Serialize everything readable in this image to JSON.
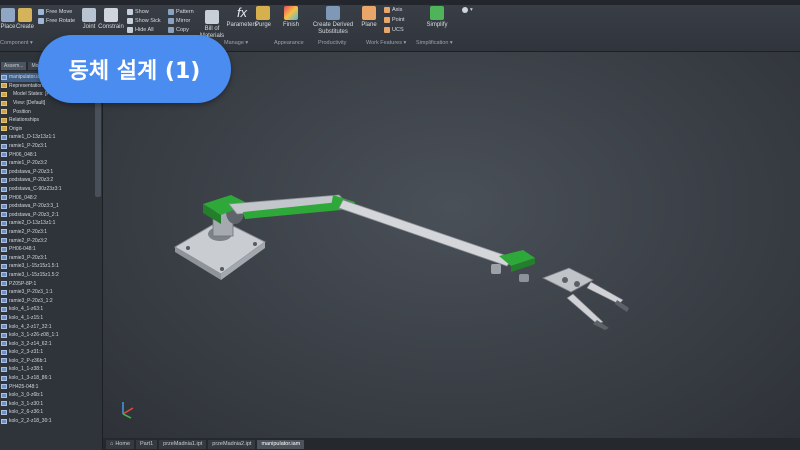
{
  "badge": {
    "title": "동체 설계 (1)"
  },
  "ribbon": {
    "place_label": "Place",
    "create_label": "Create",
    "free_move": "Free Move",
    "free_rotate": "Free Rotate",
    "joint_label": "Joint",
    "constrain_label": "Constrain",
    "show": "Show",
    "show_sick": "Show Sick",
    "hide_all": "Hide All",
    "pattern": "Pattern",
    "mirror": "Mirror",
    "copy": "Copy",
    "bill_of_materials": "Bill of Materials",
    "parameters": "Parameters",
    "purge": "Purge",
    "finish": "Finish",
    "create_derived": "Create Derived Substitutes",
    "plane": "Plane",
    "axis": "Axis",
    "point": "Point",
    "ucs": "UCS",
    "simplify": "Simplify",
    "groups": {
      "component": "Component ▾",
      "manage": "Manage ▾",
      "appearance": "Appearance",
      "productivity": "Productivity",
      "work_features": "Work Features ▾",
      "simplification": "Simplification ▾"
    }
  },
  "browser": {
    "tabs": [
      "Assem...",
      "Mod..."
    ],
    "items": [
      "manipulator.iam",
      "Representations",
      "Model States: [Prim...",
      "View: [Default]",
      "Position",
      "Relationships",
      "Origin",
      "ramie1_D-13z13z1:1",
      "ramie1_P-20z3:1",
      "PH06_048:1",
      "ramie1_P-20z3:2",
      "podstawa_P-20z3:1",
      "podstawa_P-20z3:2",
      "podstawa_C-90z23z3:1",
      "PH06_048:2",
      "podstawa_P-20z3:3_1",
      "podstawa_P-20z3_2:1",
      "ramie2_D-13z13z1:1",
      "ramie2_P-20z3:1",
      "ramie2_P-20z3:2",
      "PH06-048:1",
      "ramie3_P-20z3:1",
      "ramie3_L-15z15z1.5:1",
      "ramie3_L-15z15z1.5:2",
      "PZ05P-8P:1",
      "ramie3_P-20z3_1:1",
      "ramie3_P-20z3_1:2",
      "kolo_4_1-z63:1",
      "kolo_4_1-z15:1",
      "kolo_4_2-z17_32:1",
      "kolo_3_1-z26-z08_1:1",
      "kolo_3_2-z14_62:1",
      "kolo_2_3-z31:1",
      "kolo_2_P-z36b:1",
      "kolo_1_1-z38:1",
      "kolo_1_3-z18_86:1",
      "PH425-048:1",
      "kolo_3_0-z6b:1",
      "kolo_3_1-z30:1",
      "kolo_2_6-z36:1",
      "kolo_2_2-z18_30:1"
    ]
  },
  "doctabs": [
    "Home",
    "Part1",
    "przeMadnia1.ipt",
    "przeMadnia2.ipt",
    "manipulator.iam"
  ],
  "colors": {
    "accent": "#4a8cf0",
    "green_part": "#2fa83a",
    "viewport_bg": "#3a3f46"
  }
}
